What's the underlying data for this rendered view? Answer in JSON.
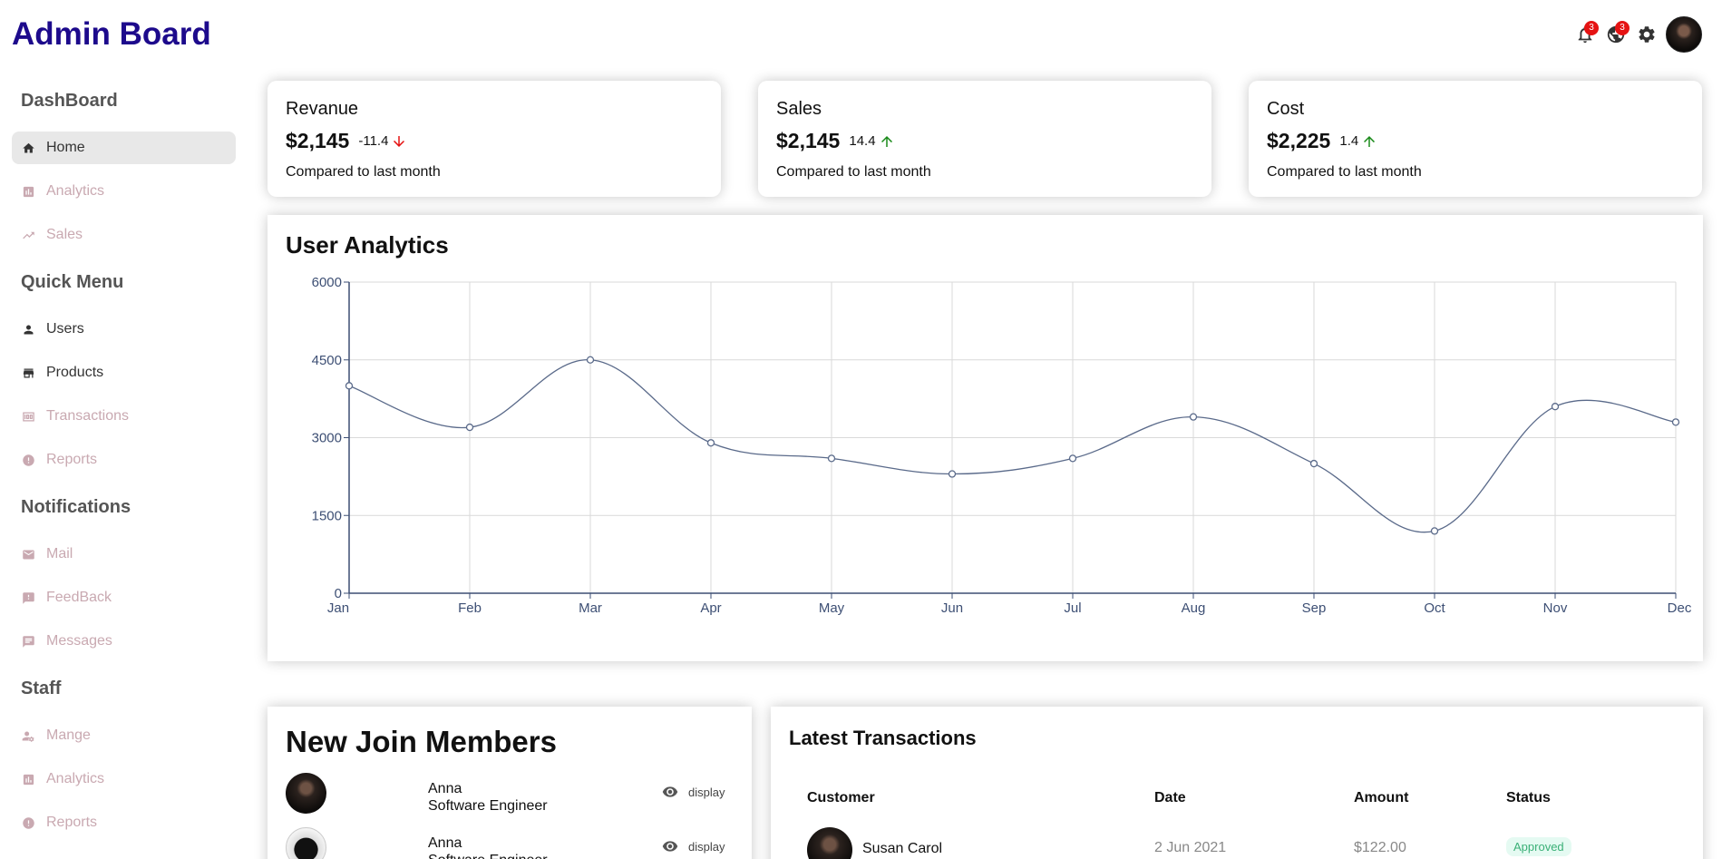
{
  "header": {
    "logo": "Admin Board",
    "notifications_badge": "3",
    "language_badge": "3",
    "icons": [
      "bell-icon",
      "globe-icon",
      "gear-icon",
      "avatar"
    ]
  },
  "sidebar": {
    "sections": [
      {
        "title": "DashBoard",
        "items": [
          {
            "label": "Home",
            "icon": "home-icon",
            "active": true
          },
          {
            "label": "Analytics",
            "icon": "bar-chart-icon"
          },
          {
            "label": "Sales",
            "icon": "trending-up-icon"
          }
        ]
      },
      {
        "title": "Quick Menu",
        "items": [
          {
            "label": "Users",
            "icon": "person-icon"
          },
          {
            "label": "Products",
            "icon": "storefront-icon"
          },
          {
            "label": "Transactions",
            "icon": "money-icon"
          },
          {
            "label": "Reports",
            "icon": "alert-circle-icon"
          }
        ]
      },
      {
        "title": "Notifications",
        "items": [
          {
            "label": "Mail",
            "icon": "mail-icon"
          },
          {
            "label": "FeedBack",
            "icon": "feedback-icon"
          },
          {
            "label": "Messages",
            "icon": "chat-icon"
          }
        ]
      },
      {
        "title": "Staff",
        "items": [
          {
            "label": "Mange",
            "icon": "manage-accounts-icon"
          },
          {
            "label": "Analytics",
            "icon": "bar-chart-icon"
          },
          {
            "label": "Reports",
            "icon": "alert-circle-icon"
          }
        ]
      }
    ]
  },
  "kpis": [
    {
      "title": "Revanue",
      "money": "$2,145",
      "rate": "-11.4",
      "direction": "down",
      "sub": "Compared to last month"
    },
    {
      "title": "Sales",
      "money": "$2,145",
      "rate": "14.4",
      "direction": "up",
      "sub": "Compared to last month"
    },
    {
      "title": "Cost",
      "money": "$2,225",
      "rate": "1.4",
      "direction": "up",
      "sub": "Compared to last month"
    }
  ],
  "colors": {
    "down": "#e51313",
    "up": "#1a8a1a",
    "line": "#5a6a8a",
    "logo": "#1d0a8c"
  },
  "chart": {
    "title": "User Analytics"
  },
  "chart_data": {
    "type": "line",
    "title": "User Analytics",
    "x": [
      "Jan",
      "Feb",
      "Mar",
      "Apr",
      "May",
      "Jun",
      "Jul",
      "Aug",
      "Sep",
      "Oct",
      "Nov",
      "Dec"
    ],
    "series": [
      {
        "values": [
          4000,
          3200,
          4500,
          2900,
          2600,
          2300,
          2600,
          3400,
          2500,
          1200,
          3600,
          3300
        ]
      }
    ],
    "ylim": [
      0,
      6000
    ],
    "yticks": [
      0,
      1500,
      3000,
      4500,
      6000
    ],
    "grid": true
  },
  "members": {
    "title": "New Join Members",
    "items": [
      {
        "name": "Anna",
        "job": "Software Engineer",
        "action": "display"
      },
      {
        "name": "Anna",
        "job": "Software Engineer",
        "action": "display"
      }
    ]
  },
  "transactions": {
    "title": "Latest Transactions",
    "headers": [
      "Customer",
      "Date",
      "Amount",
      "Status"
    ],
    "rows": [
      {
        "customer": "Susan Carol",
        "date": "2 Jun 2021",
        "amount": "$122.00",
        "status": "Approved"
      }
    ]
  }
}
